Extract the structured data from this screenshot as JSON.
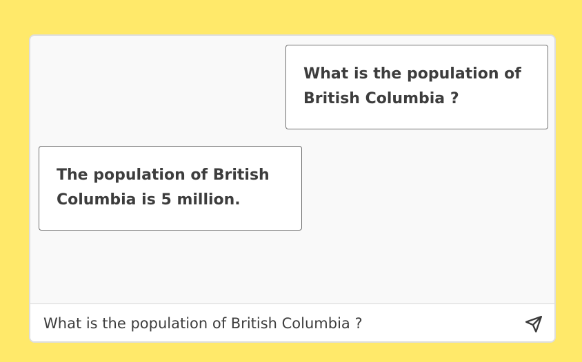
{
  "messages": {
    "user": {
      "text": "What is the population of British Columbia ?"
    },
    "bot": {
      "text": "The population of British Columbia is 5 million."
    }
  },
  "composer": {
    "value": "What is the population of British Columbia ?",
    "send_icon": "send-icon"
  },
  "colors": {
    "page_background": "#FFE96A",
    "chat_background": "#F9F9F9",
    "bubble_background": "#FFFFFF",
    "bubble_border": "#6E6E6E",
    "text": "#3D3D3D"
  }
}
